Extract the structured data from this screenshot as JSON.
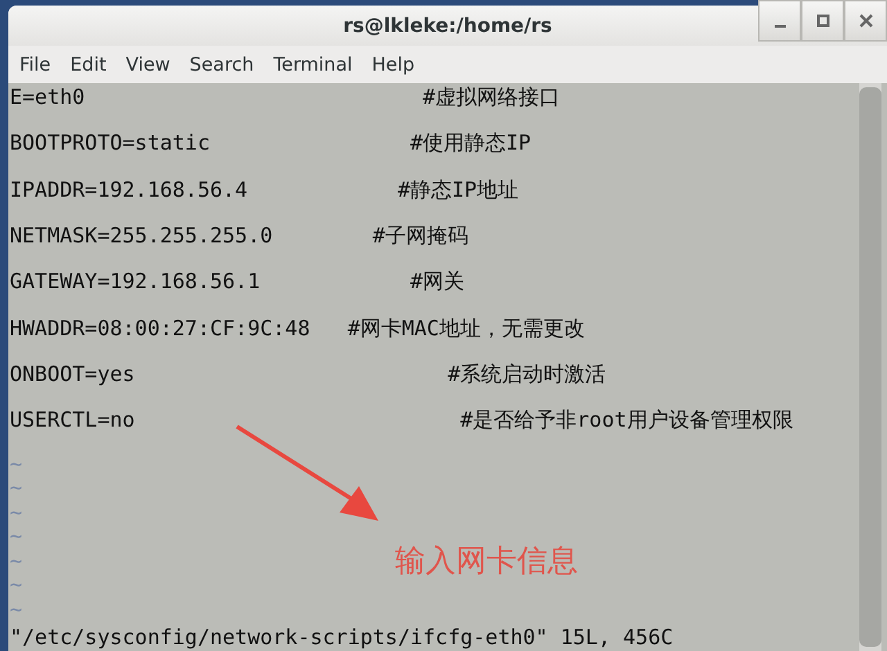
{
  "window": {
    "title": "rs@lkleke:/home/rs"
  },
  "menu": [
    "File",
    "Edit",
    "View",
    "Search",
    "Terminal",
    "Help"
  ],
  "lines": [
    "E=eth0                           #虚拟网络接口",
    "BOOTPROTO=static                #使用静态IP",
    "IPADDR=192.168.56.4            #静态IP地址",
    "NETMASK=255.255.255.0        #子网掩码",
    "GATEWAY=192.168.56.1            #网关",
    "HWADDR=08:00:27:CF:9C:48   #网卡MAC地址，无需更改",
    "ONBOOT=yes                         #系统启动时激活",
    "USERCTL=no                          #是否给予非root用户设备管理权限"
  ],
  "tildes": [
    "~",
    "~",
    "~",
    "~",
    "~",
    "~",
    "~"
  ],
  "status": "\"/etc/sysconfig/network-scripts/ifcfg-eth0\" 15L, 456C",
  "annotation": "输入网卡信息"
}
